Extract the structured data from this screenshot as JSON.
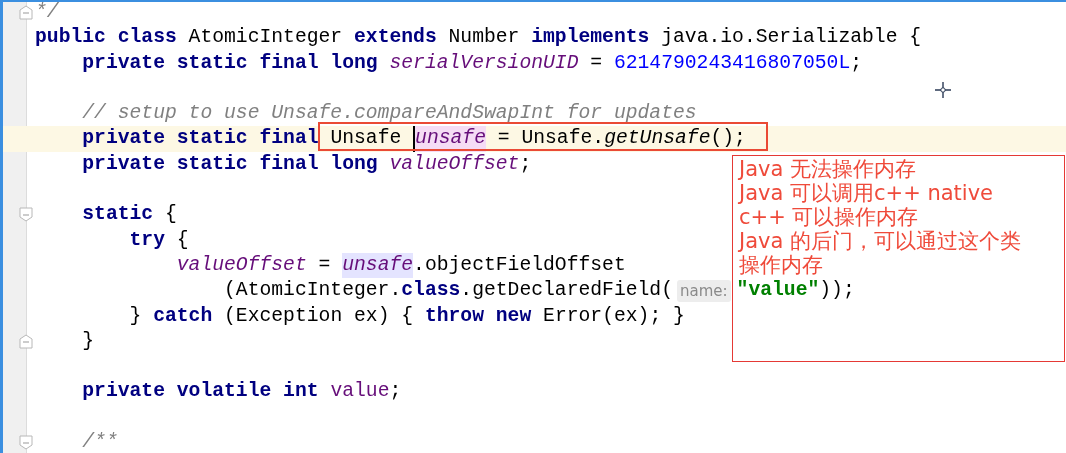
{
  "editor": {
    "lines": [
      {
        "kind": "fold-end",
        "highlighted": false,
        "tokens": [
          {
            "kind": "comment",
            "text": "*/"
          }
        ]
      },
      {
        "kind": "code",
        "highlighted": false,
        "tokens": [
          {
            "kind": "kw",
            "text": "public class "
          },
          {
            "kind": "plain",
            "text": "AtomicInteger "
          },
          {
            "kind": "kw",
            "text": "extends "
          },
          {
            "kind": "plain",
            "text": "Number "
          },
          {
            "kind": "kw",
            "text": "implements "
          },
          {
            "kind": "plain",
            "text": "java.io.Serializable {"
          }
        ]
      },
      {
        "kind": "code",
        "highlighted": false,
        "tokens": [
          {
            "kind": "kw",
            "text": "    private static final long "
          },
          {
            "kind": "field",
            "text": "serialVersionUID"
          },
          {
            "kind": "plain",
            "text": " = "
          },
          {
            "kind": "number",
            "text": "6214790243416807050L"
          },
          {
            "kind": "plain",
            "text": ";"
          }
        ]
      },
      {
        "kind": "blank",
        "highlighted": false
      },
      {
        "kind": "code",
        "highlighted": false,
        "tokens": [
          {
            "kind": "comment",
            "text": "    // setup to use Unsafe.compareAndSwapInt for updates"
          }
        ]
      },
      {
        "kind": "code",
        "highlighted": true,
        "tokens": [
          {
            "kind": "kw",
            "text": "    private static final "
          },
          {
            "kind": "plain",
            "text": "Unsafe "
          },
          {
            "kind": "field-write",
            "text": "unsafe"
          },
          {
            "kind": "plain",
            "text": " = Unsafe."
          },
          {
            "kind": "call",
            "text": "getUnsafe"
          },
          {
            "kind": "plain",
            "text": "();"
          }
        ]
      },
      {
        "kind": "code",
        "highlighted": false,
        "tokens": [
          {
            "kind": "kw",
            "text": "    private static final long "
          },
          {
            "kind": "field",
            "text": "valueOffset"
          },
          {
            "kind": "plain",
            "text": ";"
          }
        ]
      },
      {
        "kind": "blank",
        "highlighted": false
      },
      {
        "kind": "fold-start",
        "highlighted": false,
        "tokens": [
          {
            "kind": "kw",
            "text": "    static "
          },
          {
            "kind": "plain",
            "text": "{"
          }
        ]
      },
      {
        "kind": "code",
        "highlighted": false,
        "tokens": [
          {
            "kind": "kw",
            "text": "        try "
          },
          {
            "kind": "plain",
            "text": "{"
          }
        ]
      },
      {
        "kind": "code",
        "highlighted": false,
        "tokens": [
          {
            "kind": "field",
            "text": "            valueOffset"
          },
          {
            "kind": "plain",
            "text": " = "
          },
          {
            "kind": "field-read",
            "text": "unsafe"
          },
          {
            "kind": "plain",
            "text": ".objectFieldOffset"
          }
        ]
      },
      {
        "kind": "code",
        "highlighted": false,
        "tokens": [
          {
            "kind": "plain",
            "text": "                (AtomicInteger."
          },
          {
            "kind": "kw",
            "text": "class"
          },
          {
            "kind": "plain",
            "text": ".getDeclaredField("
          },
          {
            "kind": "hint",
            "text": "name:"
          },
          {
            "kind": "string",
            "text": "\"value\""
          },
          {
            "kind": "plain",
            "text": "));"
          }
        ]
      },
      {
        "kind": "code",
        "highlighted": false,
        "tokens": [
          {
            "kind": "plain",
            "text": "        } "
          },
          {
            "kind": "kw",
            "text": "catch "
          },
          {
            "kind": "plain",
            "text": "(Exception ex) { "
          },
          {
            "kind": "kw",
            "text": "throw new "
          },
          {
            "kind": "plain",
            "text": "Error(ex); }"
          }
        ]
      },
      {
        "kind": "fold-end",
        "highlighted": false,
        "tokens": [
          {
            "kind": "plain",
            "text": "    }"
          }
        ]
      },
      {
        "kind": "blank",
        "highlighted": false
      },
      {
        "kind": "code",
        "highlighted": false,
        "tokens": [
          {
            "kind": "kw",
            "text": "    private volatile int "
          },
          {
            "kind": "ifield",
            "text": "value"
          },
          {
            "kind": "plain",
            "text": ";"
          }
        ]
      },
      {
        "kind": "blank",
        "highlighted": false
      },
      {
        "kind": "fold-start",
        "highlighted": false,
        "tokens": [
          {
            "kind": "comment",
            "text": "    /**"
          }
        ]
      }
    ]
  },
  "annotations": [
    {
      "kind": "box"
    },
    {
      "kind": "note",
      "lines": [
        "Java 无法操作内存",
        "Java 可以调用c++  native",
        "c++ 可以操作内存",
        "Java 的后门，可以通过这个类",
        "操作内存"
      ]
    }
  ]
}
